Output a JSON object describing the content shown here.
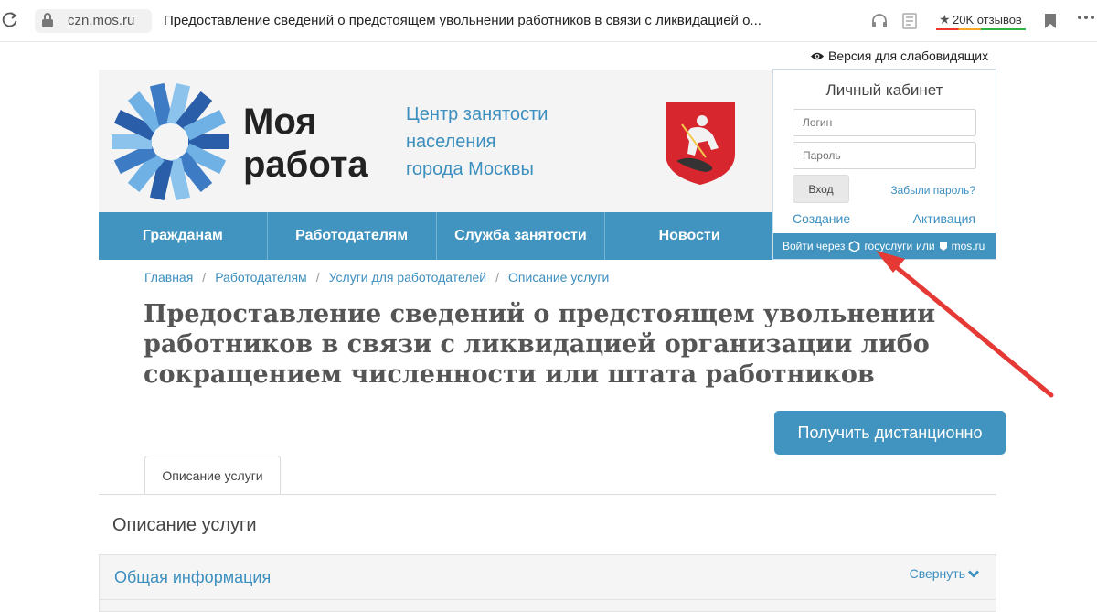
{
  "browser": {
    "domain": "czn.mos.ru",
    "tab_title": "Предоставление сведений о предстоящем увольнении работников в связи с ликвидацией о...",
    "reviews": "20K отзывов"
  },
  "header": {
    "a11y_link": "Версия для слабовидящих",
    "logo_line1": "Моя",
    "logo_line2": "работа",
    "center_line1": "Центр занятости",
    "center_line2": "населения",
    "center_line3": "города Москвы"
  },
  "nav": {
    "items": [
      {
        "label": "Гражданам"
      },
      {
        "label": "Работодателям"
      },
      {
        "label": "Служба занятости"
      },
      {
        "label": "Новости"
      }
    ]
  },
  "login": {
    "title": "Личный кабинет",
    "login_placeholder": "Логин",
    "password_placeholder": "Пароль",
    "submit_label": "Вход",
    "forgot_label": "Забыли пароль?",
    "create_label": "Создание",
    "activate_label": "Активация",
    "via_label": "Войти через",
    "gosuslugi_label": "госуслуги",
    "or_label": "или",
    "mosru_label": "mos.ru"
  },
  "breadcrumb": {
    "items": [
      {
        "label": "Главная"
      },
      {
        "label": "Работодателям"
      },
      {
        "label": "Услуги для работодателей"
      },
      {
        "label": "Описание услуги"
      }
    ],
    "separator": "/"
  },
  "main": {
    "title": "Предоставление сведений о предстоящем увольнении работников в связи с ликвидацией организации либо сокращением численности или штата работников",
    "remote_button": "Получить дистанционно",
    "tab_label": "Описание услуги",
    "section_title": "Описание услуги",
    "panel_title": "Общая информация",
    "panel_toggle": "Свернуть"
  },
  "colors": {
    "brand_blue": "#4194bf",
    "link_blue": "#3c8fbf",
    "annotation_red": "#e53935"
  }
}
